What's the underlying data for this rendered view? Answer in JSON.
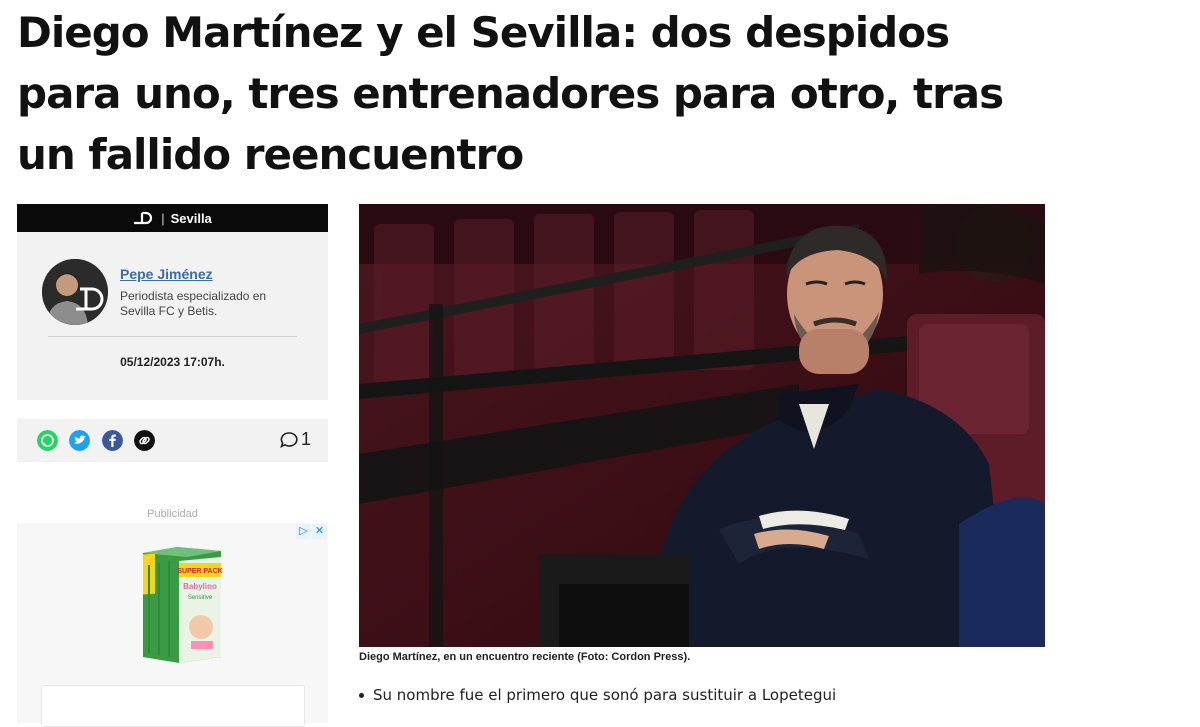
{
  "article": {
    "headline": "Diego Martínez y el Sevilla: dos despidos para uno, tres entrenadores para otro, tras un fallido reencuentro",
    "section": "Sevilla",
    "caption": "Diego Martínez, en un encuentro reciente (Foto: Cordon Press).",
    "bullets": [
      "Su nombre fue el primero que sonó para sustituir a Lopetegui"
    ]
  },
  "author": {
    "name": "Pepe Jiménez",
    "bio": "Periodista especializado en Sevilla FC y Betis.",
    "date": "05/12/2023 17:07h."
  },
  "share": {
    "icons": [
      "whatsapp-icon",
      "twitter-icon",
      "facebook-icon",
      "link-icon"
    ],
    "comment_count": "1"
  },
  "ad": {
    "label": "Publicidad",
    "product_text": [
      "SUPER PACK",
      "Babylino",
      "Sensitive"
    ]
  },
  "colors": {
    "author_link": "#3a6ea5",
    "whatsapp": "#25d366",
    "twitter": "#1da1f2",
    "facebook": "#3b5998",
    "section_bar": "#0a0a0a"
  }
}
